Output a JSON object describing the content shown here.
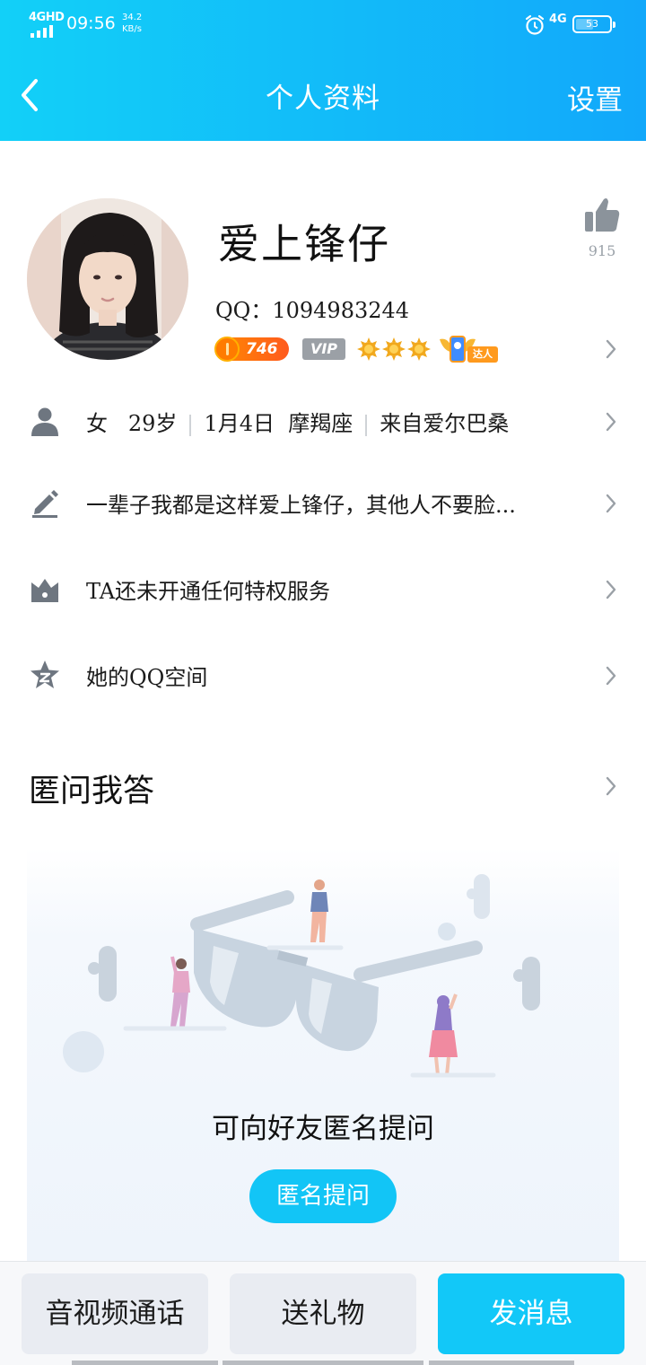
{
  "status_bar": {
    "network_label": "4GHD",
    "time": "09:56",
    "speed_value": "34.2",
    "speed_unit": "KB/s",
    "network_type": "4G",
    "battery": "53"
  },
  "nav": {
    "title": "个人资料",
    "settings_label": "设置"
  },
  "profile": {
    "name": "爱上锋仔",
    "qq": "QQ：1094983244",
    "likes": "915",
    "level": "746",
    "vip_label": "VIP",
    "talent_label": "达人"
  },
  "rows": {
    "info": {
      "gender": "女",
      "age": "29岁",
      "birthday": "1月4日  摩羯座",
      "hometown": "来自爱尔巴桑"
    },
    "signature": "一辈子我都是这样爱上锋仔，其他人不要脸...",
    "privilege": "TA还未开通任何特权服务",
    "qzone": "她的QQ空间"
  },
  "qa": {
    "title": "匿问我答",
    "prompt": "可向好友匿名提问",
    "button": "匿名提问"
  },
  "bottom": {
    "call": "音视频通话",
    "gift": "送礼物",
    "message": "发消息"
  },
  "colors": {
    "header_gradient_start": "#12d0f8",
    "header_gradient_end": "#12a8fa",
    "accent": "#12c8f8",
    "icon_grey": "#6e7680"
  }
}
